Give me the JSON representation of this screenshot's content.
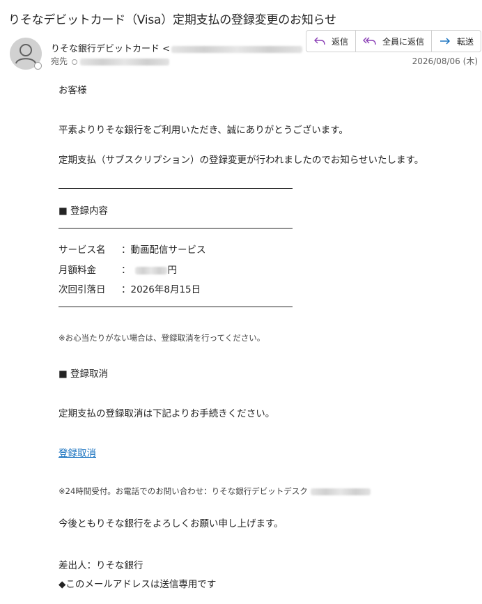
{
  "subject": "りそなデビットカード（Visa）定期支払の登録変更のお知らせ",
  "sender": {
    "name": "りそな銀行デビットカード <"
  },
  "recipient": {
    "label": "宛先"
  },
  "date": "2026/08/06 (木)",
  "actions": {
    "reply": "返信",
    "reply_all": "全員に返信",
    "forward": "転送"
  },
  "body": {
    "greeting": "お客様",
    "intro": "平素よりりそな銀行をご利用いただき、誠にありがとうございます。",
    "notice": "定期支払（サブスクリプション）の登録変更が行われましたのでお知らせいたします。",
    "section1_title": "■ 登録内容",
    "details": [
      {
        "label": "サービス名",
        "value": "：動画配信サービス"
      },
      {
        "label": "月額料金",
        "value": "：",
        "suffix": "円"
      },
      {
        "label": "次回引落日",
        "value": "：2026年8月15日"
      }
    ],
    "note1": "※お心当たりがない場合は、登録取消を行ってください。",
    "section2_title": "■ 登録取消",
    "cancel_text": "定期支払の登録取消は下記よりお手続きください。",
    "cancel_link": "登録取消",
    "note2": "※24時間受付。お電話でのお問い合わせ：りそな銀行デビットデスク",
    "closing": "今後ともりそな銀行をよろしくお願い申し上げます。",
    "signature": "差出人：りそな銀行",
    "footer": "◆このメールアドレスは送信専用です"
  }
}
